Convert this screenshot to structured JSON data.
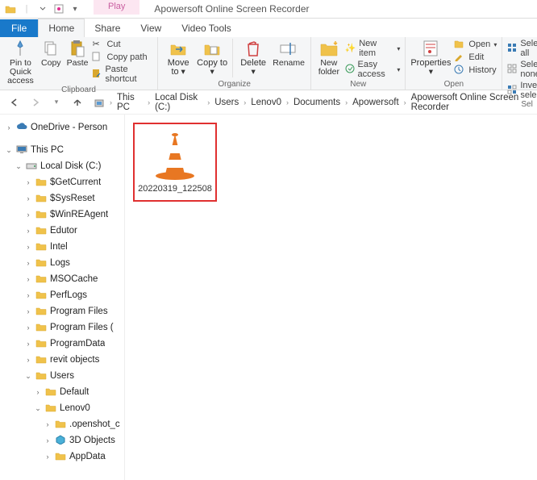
{
  "title": "Apowersoft Online Screen Recorder",
  "context_tab": "Play",
  "tabs": {
    "file": "File",
    "home": "Home",
    "share": "Share",
    "view": "View",
    "video": "Video Tools"
  },
  "ribbon": {
    "clipboard": {
      "label": "Clipboard",
      "pin": "Pin to Quick access",
      "copy": "Copy",
      "paste": "Paste",
      "cut": "Cut",
      "copypath": "Copy path",
      "pasteshortcut": "Paste shortcut"
    },
    "organize": {
      "label": "Organize",
      "moveto": "Move to",
      "copyto": "Copy to",
      "delete": "Delete",
      "rename": "Rename"
    },
    "new": {
      "label": "New",
      "newfolder": "New folder",
      "newitem": "New item",
      "easyaccess": "Easy access"
    },
    "open": {
      "label": "Open",
      "properties": "Properties",
      "open": "Open",
      "edit": "Edit",
      "history": "History"
    },
    "select": {
      "label": "Sel",
      "selectall": "Select all",
      "selectnone": "Select none",
      "invert": "Invert select"
    }
  },
  "breadcrumbs": [
    "This PC",
    "Local Disk (C:)",
    "Users",
    "Lenov0",
    "Documents",
    "Apowersoft",
    "Apowersoft Online Screen Recorder"
  ],
  "tree": {
    "onedrive": "OneDrive - Person",
    "thispc": "This PC",
    "localdisk": "Local Disk (C:)",
    "folders": [
      "$GetCurrent",
      "$SysReset",
      "$WinREAgent",
      "Edutor",
      "Intel",
      "Logs",
      "MSOCache",
      "PerfLogs",
      "Program Files",
      "Program Files (",
      "ProgramData",
      "revit objects",
      "Users"
    ],
    "users_children": {
      "default": "Default",
      "lenov0": "Lenov0",
      "openshot": ".openshot_c",
      "objects3d": "3D Objects",
      "appdata": "AppData"
    }
  },
  "file": {
    "name": "20220319_122508"
  }
}
